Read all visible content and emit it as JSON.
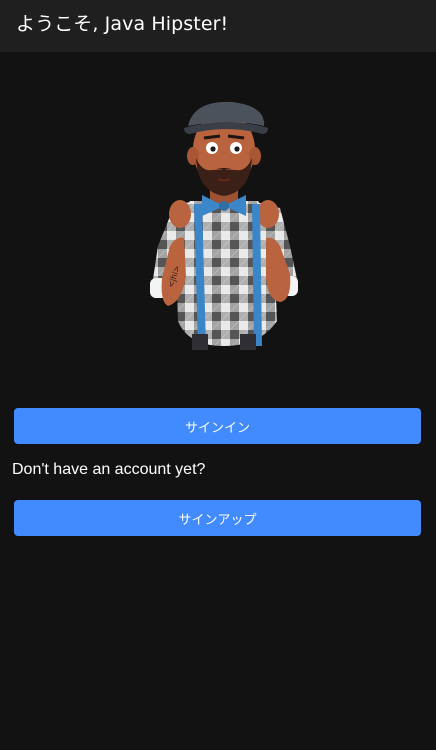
{
  "header": {
    "title": "ようこそ, Java Hipster!"
  },
  "hero": {
    "illustration": "java-hipster-character",
    "tattoo_text": "<jhi>"
  },
  "auth": {
    "signin_label": "サインイン",
    "signup_prompt": "Don't have an account yet?",
    "signup_label": "サインアップ"
  },
  "colors": {
    "background": "#121212",
    "toolbar": "#1f1f1f",
    "primary_button": "#428bff",
    "text": "#ffffff"
  }
}
